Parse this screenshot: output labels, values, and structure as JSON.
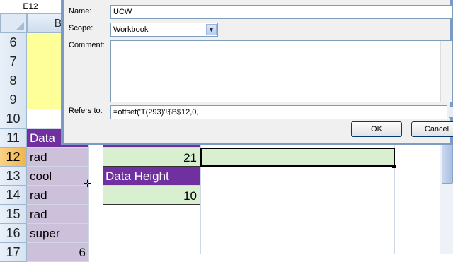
{
  "name_box": "E12",
  "column_header_visible": "B",
  "rows": [
    "6",
    "7",
    "8",
    "9",
    "10",
    "11",
    "12",
    "13",
    "14",
    "15",
    "16",
    "17"
  ],
  "active_row": "12",
  "column_b_cells": {
    "r11": "Data",
    "r12": "rad",
    "r13": "cool",
    "r14": "rad",
    "r15": "rad",
    "r16": "super",
    "r17": "6"
  },
  "value_cell": "21",
  "data_height_header": "Data Height",
  "data_height_value": "10",
  "dialog": {
    "name_label": "Name:",
    "name_value": "UCW",
    "scope_label": "Scope:",
    "scope_value": "Workbook",
    "comment_label": "Comment:",
    "comment_value": "",
    "refers_label": "Refers to:",
    "refers_value": "=offset('T(293)'!$B$12,0,",
    "ok_label": "OK",
    "cancel_label": "Cancel"
  },
  "colors": {
    "purple": "#7030a0",
    "lavender": "#ccc0da",
    "yellow": "#ffff99",
    "green": "#d8f0d0",
    "active_row": "#f1b44c"
  }
}
